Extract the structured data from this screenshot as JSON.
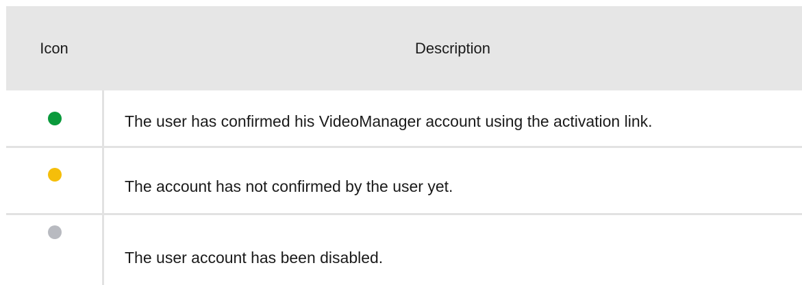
{
  "table": {
    "headers": {
      "icon": "Icon",
      "description": "Description"
    },
    "rows": [
      {
        "icon": "green-status-dot-icon",
        "color": "#0a9a3c",
        "description": "The user has confirmed his VideoManager account using the activation link."
      },
      {
        "icon": "yellow-status-dot-icon",
        "color": "#f5be0a",
        "description": "The account has not confirmed by the user yet."
      },
      {
        "icon": "grey-status-dot-icon",
        "color": "#b8bac0",
        "description": "The user account has been disabled."
      }
    ]
  }
}
